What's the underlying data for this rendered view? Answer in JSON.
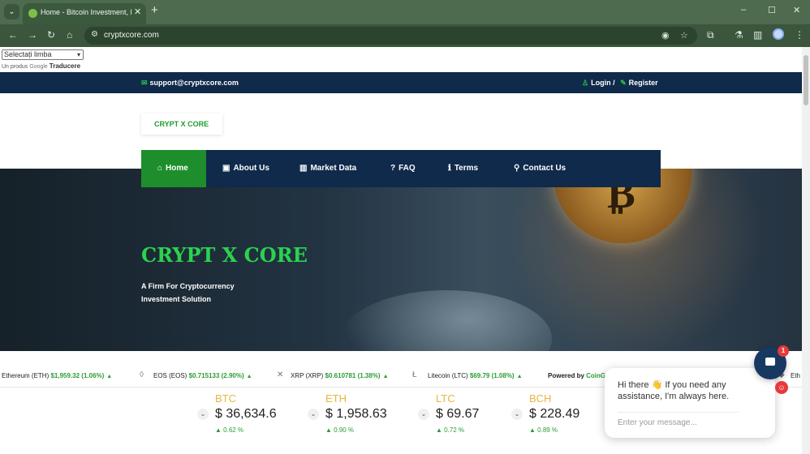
{
  "browser": {
    "tab_title": "Home - Bitcoin Investment, Bitc",
    "tab_close": "✕",
    "new_tab": "+",
    "url": "cryptxcore.com",
    "window_controls": [
      "–",
      "☐",
      "✕"
    ]
  },
  "translate": {
    "select_label": "Selectați limba",
    "credit_prefix": "Un produs",
    "credit_google": "Google",
    "credit_link": "Traducere"
  },
  "topbar": {
    "email": "support@cryptxcore.com",
    "login": "Login /",
    "register": "Register"
  },
  "logo": {
    "text": "CRYPT X CORE"
  },
  "nav": {
    "items": [
      {
        "label": "Home",
        "icon": "home-icon"
      },
      {
        "label": "About Us",
        "icon": "id-card-icon"
      },
      {
        "label": "Market Data",
        "icon": "bar-chart-icon"
      },
      {
        "label": "FAQ",
        "icon": "question-icon"
      },
      {
        "label": "Terms",
        "icon": "info-icon"
      },
      {
        "label": "Contact Us",
        "icon": "map-marker-icon"
      }
    ]
  },
  "hero": {
    "title": "CRYPT X CORE",
    "subtitle_line1": "A Firm For Cryptocurrency",
    "subtitle_line2": "Investment Solution"
  },
  "ticker": {
    "items": [
      {
        "name": "Ethereum (ETH)",
        "price": "$1,959.32 (1.06%)"
      },
      {
        "name": "EOS (EOS)",
        "price": "$0.715133 (2.90%)"
      },
      {
        "name": "XRP (XRP)",
        "price": "$0.610781 (1.38%)"
      },
      {
        "name": "Litecoin (LTC)",
        "price": "$69.79 (1.08%)"
      }
    ],
    "powered_prefix": "Powered by",
    "powered_brand": "CoinG",
    "trailing": "Eth"
  },
  "cards": [
    {
      "symbol": "BTC",
      "value": "$ 36,634.6",
      "change": "0.62 %"
    },
    {
      "symbol": "ETH",
      "value": "$ 1,958.63",
      "change": "0.90 %"
    },
    {
      "symbol": "LTC",
      "value": "$ 69.67",
      "change": "0.72 %"
    },
    {
      "symbol": "BCH",
      "value": "$ 228.49",
      "change": "0.89 %"
    }
  ],
  "chat": {
    "message": "Hi there 👋 If you need any assistance, I'm always here.",
    "placeholder": "Enter your message...",
    "badge": "1"
  },
  "colors": {
    "accent_green": "#1e8e2d",
    "navy": "#0f2a4a",
    "title_green": "#2bd24f",
    "coin_gold": "#e6b640",
    "chrome_green": "#4e6b4f"
  }
}
